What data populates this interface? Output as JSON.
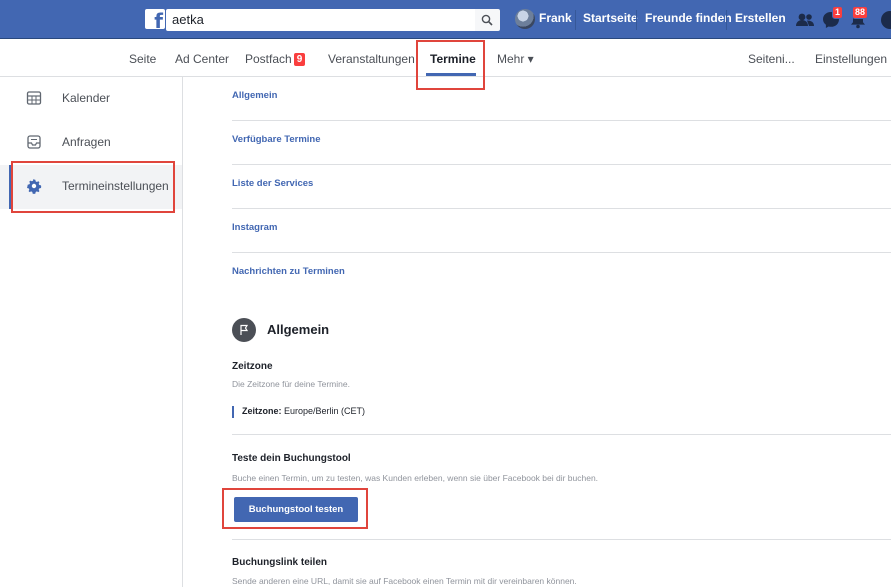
{
  "topbar": {
    "search_value": "aetka",
    "user_name": "Frank",
    "nav_links": [
      "Startseite",
      "Freunde finden",
      "Erstellen"
    ],
    "messages_badge": "1",
    "notifications_badge": "88"
  },
  "page_nav": {
    "tabs": [
      "Seite",
      "Ad Center",
      "Postfach",
      "Veranstaltungen",
      "Termine",
      "Mehr ▾",
      "Seiteni...",
      "Einstellungen"
    ],
    "postfach_badge": "9",
    "active_tab": "Termine"
  },
  "sidebar": {
    "items": [
      {
        "label": "Kalender",
        "icon": "calendar-icon"
      },
      {
        "label": "Anfragen",
        "icon": "inbox-icon"
      },
      {
        "label": "Termineinstellungen",
        "icon": "gear-icon"
      }
    ]
  },
  "main": {
    "links": [
      "Allgemein",
      "Verfügbare Termine",
      "Liste der Services",
      "Instagram",
      "Nachrichten zu Terminen"
    ],
    "section_title": "Allgemein",
    "timezone": {
      "heading": "Zeitzone",
      "description": "Die Zeitzone für deine Termine.",
      "label": "Zeitzone:",
      "value": "Europe/Berlin (CET)"
    },
    "test_tool": {
      "heading": "Teste dein Buchungstool",
      "description": "Buche einen Termin, um zu testen, was Kunden erleben, wenn sie über Facebook bei dir buchen.",
      "button": "Buchungstool testen"
    },
    "share_link": {
      "heading": "Buchungslink teilen",
      "description": "Sende anderen eine URL, damit sie auf Facebook einen Termin mit dir vereinbaren können."
    }
  },
  "colors": {
    "brand_blue": "#4267b2",
    "highlight_red": "#e0453c",
    "badge_red": "#fa3e3e"
  }
}
